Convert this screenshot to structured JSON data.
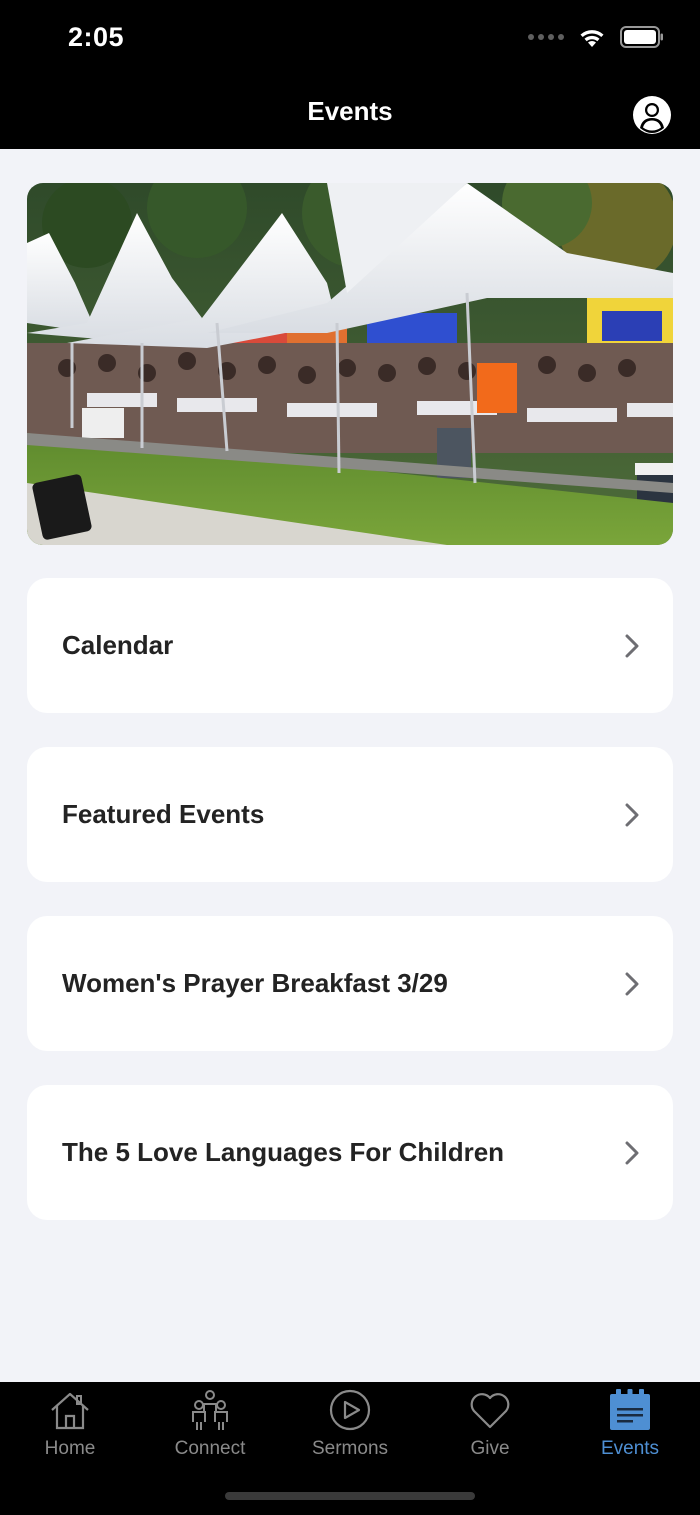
{
  "status_bar": {
    "time": "2:05"
  },
  "nav": {
    "title": "Events",
    "profile_icon": "person-circle-icon"
  },
  "hero": {
    "image": "outdoor-event-tents-photo"
  },
  "rows": [
    {
      "label": "Calendar"
    },
    {
      "label": "Featured Events"
    },
    {
      "label": "Women's Prayer Breakfast 3/29"
    },
    {
      "label": "The 5 Love Languages For Children"
    }
  ],
  "tabs": [
    {
      "label": "Home",
      "icon": "house-icon"
    },
    {
      "label": "Connect",
      "icon": "people-icon"
    },
    {
      "label": "Sermons",
      "icon": "play-circle-icon"
    },
    {
      "label": "Give",
      "icon": "heart-icon"
    },
    {
      "label": "Events",
      "icon": "calendar-icon"
    }
  ],
  "colors": {
    "accent": "#4e8fd3",
    "background": "#f2f3f8",
    "bar": "#000000"
  }
}
